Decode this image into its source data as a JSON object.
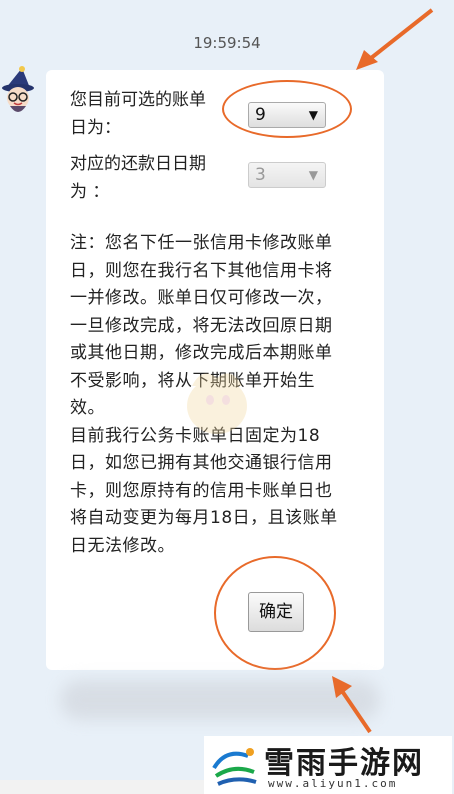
{
  "chat": {
    "timestamp": "19:59:54"
  },
  "form": {
    "billing_label_line1": "您目前可选的账单",
    "billing_label_line2": "日为：",
    "billing_value": "9",
    "repay_label_line1": "对应的还款日日期",
    "repay_label_line2": "为 ：",
    "repay_value": "3",
    "caret": "▼"
  },
  "note": {
    "lines": [
      "注：您名下任一张信用卡修改账单",
      "日，则您在我行名下其他信用卡将",
      "一并修改。账单日仅可修改一次，",
      "一旦修改完成，将无法改回原日期",
      "或其他日期，修改完成后本期账单",
      "不受影响，将从下期账单开始生",
      "效。",
      "目前我行公务卡账单日固定为18",
      "日，如您已拥有其他交通银行信用",
      "卡，则您原持有的信用卡账单日也",
      "将自动变更为每月18日，且该账单",
      "日无法修改。"
    ]
  },
  "buttons": {
    "confirm": "确定"
  },
  "watermark": {
    "title": "雪雨手游网",
    "url": "www.aliyun1.com"
  },
  "colors": {
    "annotation": "#e86a2a",
    "background": "#e8f0f8"
  }
}
